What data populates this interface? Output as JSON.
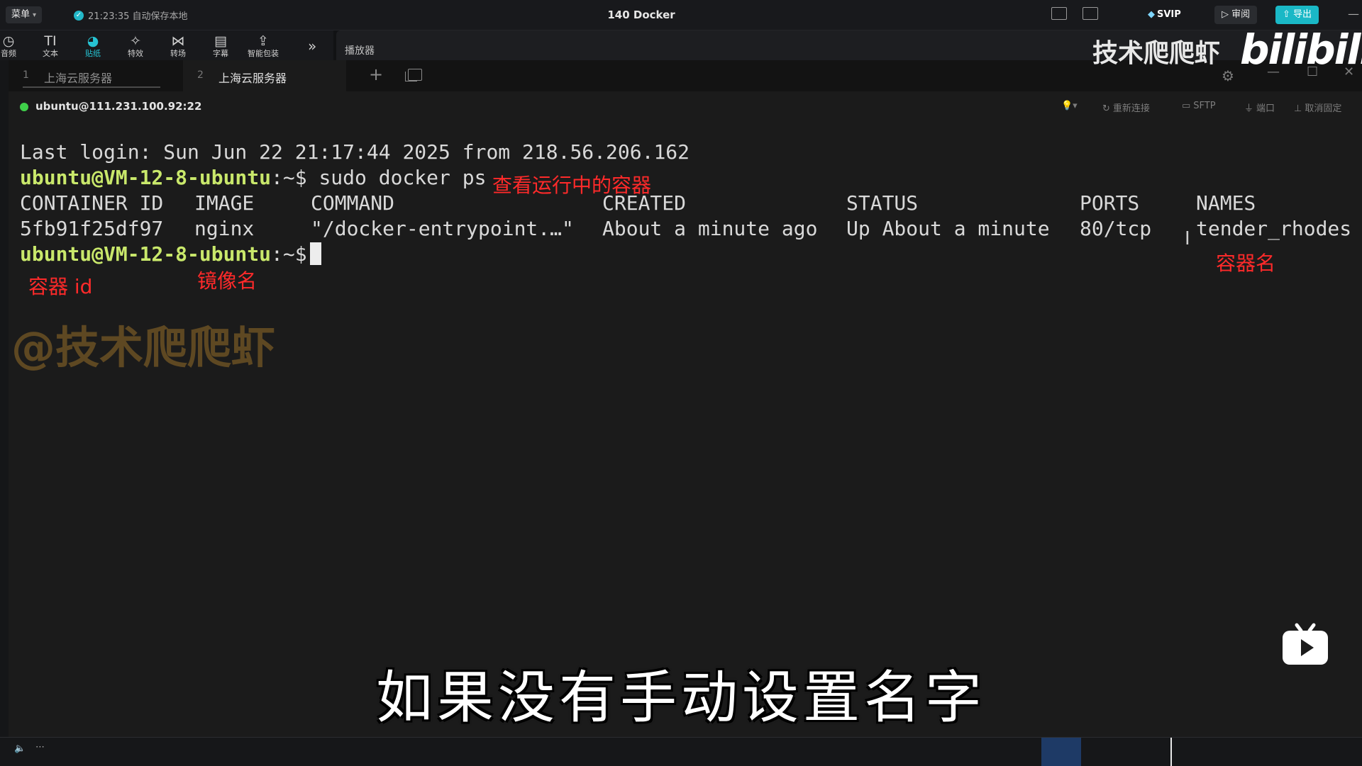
{
  "editor": {
    "menu_label": "菜单",
    "autosave_text": "21:23:35 自动保存本地",
    "project_title": "140 Docker",
    "svip_label": "SVIP",
    "review_label": "审阅",
    "export_label": "导出",
    "tools": [
      {
        "icon": "audio-icon",
        "glyph": "◷",
        "label": "音频"
      },
      {
        "icon": "text-icon",
        "glyph": "TI",
        "label": "文本"
      },
      {
        "icon": "sticker-icon",
        "glyph": "◕",
        "label": "贴纸"
      },
      {
        "icon": "effects-icon",
        "glyph": "✧",
        "label": "特效"
      },
      {
        "icon": "transition-icon",
        "glyph": "⋈",
        "label": "转场"
      },
      {
        "icon": "caption-icon",
        "glyph": "▤",
        "label": "字幕"
      },
      {
        "icon": "smart-package-icon",
        "glyph": "⇪",
        "label": "智能包装"
      }
    ],
    "player_label": "播放器"
  },
  "terminal_app": {
    "tabs": [
      {
        "num": "1",
        "name": "上海云服务器"
      },
      {
        "num": "2",
        "name": "上海云服务器"
      }
    ],
    "connection": "ubuntu@111.231.100.92:22",
    "actions": {
      "reconnect": "重新连接",
      "sftp": "SFTP",
      "port": "端口",
      "unpin": "取消固定"
    }
  },
  "terminal": {
    "last_login": "Last login: Sun Jun 22 21:17:44 2025 from 218.56.206.162",
    "prompt_user": "ubuntu@VM-12-8-ubuntu",
    "prompt_tail": ":~$",
    "command": " sudo docker ps",
    "headers": [
      "CONTAINER ID",
      "IMAGE",
      "COMMAND",
      "CREATED",
      "STATUS",
      "PORTS",
      "NAMES"
    ],
    "row": [
      "5fb91f25df97",
      "nginx",
      "\"/docker-entrypoint.…\"",
      "About a minute ago",
      "Up About a minute",
      "80/tcp",
      "tender_rhodes"
    ]
  },
  "annotations": {
    "command_note": "查看运行中的容器",
    "container_id_note": "容器 id",
    "image_note": "镜像名",
    "name_note": "容器名"
  },
  "overlay": {
    "watermark": "@技术爬爬虾",
    "brand": "技术爬爬虾",
    "bilibili": "bilibili",
    "subtitle": "如果没有手动设置名字"
  }
}
